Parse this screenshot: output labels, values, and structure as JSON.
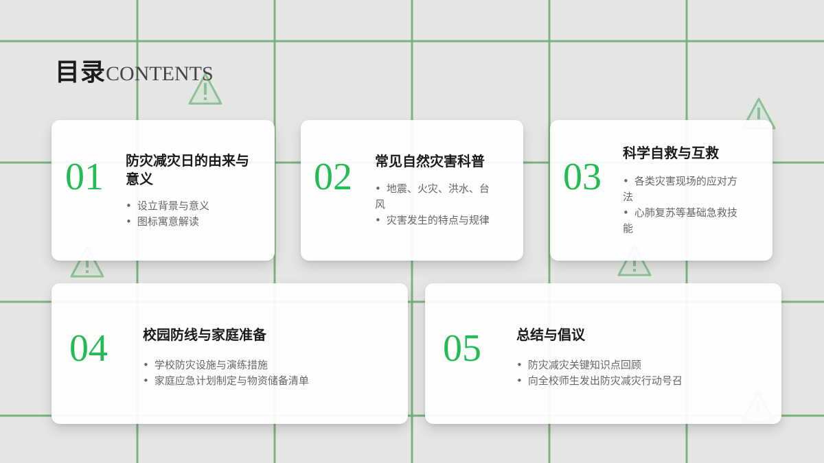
{
  "header": {
    "title_cn": "目录",
    "title_en": "CONTENTS"
  },
  "colors": {
    "accent": "#22bb55",
    "grid_line": "#6fad77",
    "background": "#e6e6e4"
  },
  "icons": [
    "warning-triangle-icon"
  ],
  "cards": [
    {
      "number": "01",
      "title": "防灾减灾日的由来与意义",
      "bullets": [
        "设立背景与意义",
        "图标寓意解读"
      ]
    },
    {
      "number": "02",
      "title": "常见自然灾害科普",
      "bullets": [
        "地震、火灾、洪水、台风",
        "灾害发生的特点与规律"
      ]
    },
    {
      "number": "03",
      "title": "科学自救与互救",
      "bullets": [
        "各类灾害现场的应对方法",
        "心肺复苏等基础急救技能"
      ]
    },
    {
      "number": "04",
      "title": "校园防线与家庭准备",
      "bullets": [
        "学校防灾设施与演练措施",
        "家庭应急计划制定与物资储备清单"
      ]
    },
    {
      "number": "05",
      "title": "总结与倡议",
      "bullets": [
        "防灾减灾关键知识点回顾",
        "向全校师生发出防灾减灾行动号召"
      ]
    }
  ]
}
